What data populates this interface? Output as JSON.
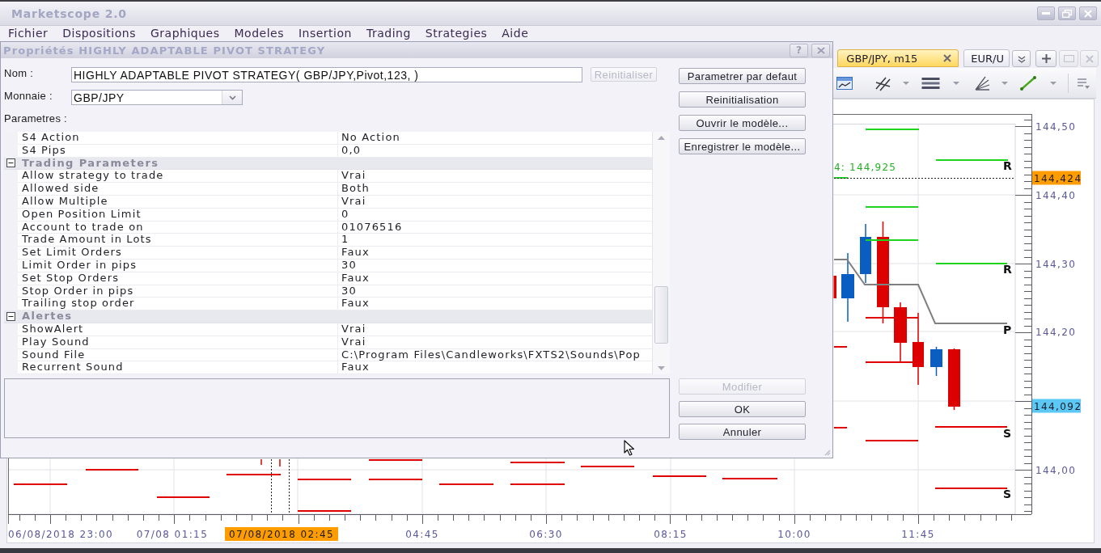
{
  "window": {
    "title": "Marketscope 2.0"
  },
  "menu": [
    "Fichier",
    "Dispositions",
    "Graphiques",
    "Modeles",
    "Insertion",
    "Trading",
    "Strategies",
    "Aide"
  ],
  "chart_window": {
    "tabs": [
      {
        "label": "GBP/JPY, m15",
        "selected": true
      },
      {
        "label": "EUR/U",
        "selected": false
      }
    ],
    "annotation": "4: 144,925",
    "level_labels": [
      "R",
      "R",
      "P",
      "S",
      "S"
    ],
    "price_axis": [
      {
        "label": "144,50",
        "kind": "tick"
      },
      {
        "label": "144,424",
        "kind": "marker",
        "color": "#ff9c00"
      },
      {
        "label": "144,40",
        "kind": "tick"
      },
      {
        "label": "144,30",
        "kind": "tick"
      },
      {
        "label": "144,20",
        "kind": "tick"
      },
      {
        "label": "144,092",
        "kind": "marker",
        "color": "#5cc8f5"
      },
      {
        "label": "144,00",
        "kind": "tick"
      }
    ],
    "time_axis": [
      {
        "label": "06/08/2018 23:00",
        "kind": "tick"
      },
      {
        "label": "07/08 01:15",
        "kind": "tick"
      },
      {
        "label": "07/08/2018 02:45",
        "kind": "marker",
        "color": "#ff9c00"
      },
      {
        "label": "04:45",
        "kind": "tick"
      },
      {
        "label": "06:30",
        "kind": "tick"
      },
      {
        "label": "08:15",
        "kind": "tick"
      },
      {
        "label": "10:00",
        "kind": "tick"
      },
      {
        "label": "11:45",
        "kind": "tick"
      }
    ]
  },
  "dialog": {
    "title": "Propriétés HIGHLY ADAPTABLE PIVOT STRATEGY",
    "help_button": "?",
    "name_field": {
      "label": "Nom :",
      "value": "HIGHLY ADAPTABLE PIVOT STRATEGY( GBP/JPY,Pivot,123, )"
    },
    "reset_button": {
      "label": "Reinitialiser",
      "disabled": true
    },
    "currency_field": {
      "label": "Monnaie :",
      "value": "GBP/JPY"
    },
    "parameters_label": "Parametres :",
    "parameters": [
      {
        "kind": "property",
        "name": "S4 Action",
        "value": "No Action"
      },
      {
        "kind": "property",
        "name": "S4 Pips",
        "value": "0,0"
      },
      {
        "kind": "category",
        "name": "Trading Parameters",
        "expanded": true,
        "children": [
          {
            "kind": "property",
            "name": "Allow strategy to trade",
            "value": "Vrai"
          },
          {
            "kind": "property",
            "name": "Allowed side",
            "value": "Both"
          },
          {
            "kind": "property",
            "name": "Allow Multiple",
            "value": "Vrai"
          },
          {
            "kind": "property",
            "name": "Open Position Limit",
            "value": "0"
          },
          {
            "kind": "property",
            "name": "Account to trade on",
            "value": "01076516"
          },
          {
            "kind": "property",
            "name": "Trade Amount in Lots",
            "value": "1"
          },
          {
            "kind": "property",
            "name": "Set Limit Orders",
            "value": "Faux"
          },
          {
            "kind": "property",
            "name": "Limit Order in pips",
            "value": "30"
          },
          {
            "kind": "property",
            "name": "Set Stop Orders",
            "value": "Faux"
          },
          {
            "kind": "property",
            "name": "Stop Order in pips",
            "value": "30"
          },
          {
            "kind": "property",
            "name": "Trailing stop order",
            "value": "Faux"
          }
        ]
      },
      {
        "kind": "category",
        "name": "Alertes",
        "expanded": true,
        "children": [
          {
            "kind": "property",
            "name": "ShowAlert",
            "value": "Vrai"
          },
          {
            "kind": "property",
            "name": "Play Sound",
            "value": "Vrai"
          },
          {
            "kind": "property",
            "name": "Sound File",
            "value": "C:\\Program Files\\Candleworks\\FXTS2\\Sounds\\Pop"
          },
          {
            "kind": "property",
            "name": "Recurrent Sound",
            "value": "Faux"
          }
        ]
      }
    ],
    "side_buttons": [
      {
        "label": "Parametrer par defaut",
        "disabled": false
      },
      {
        "label": "Reinitialisation",
        "disabled": false
      },
      {
        "label": "Ouvrir le modèle...",
        "disabled": false
      },
      {
        "label": "Enregistrer le modèle...",
        "disabled": false
      }
    ],
    "bottom_buttons": [
      {
        "label": "Modifier",
        "disabled": true
      },
      {
        "label": "OK",
        "disabled": false
      },
      {
        "label": "Annuler",
        "disabled": false
      }
    ]
  }
}
